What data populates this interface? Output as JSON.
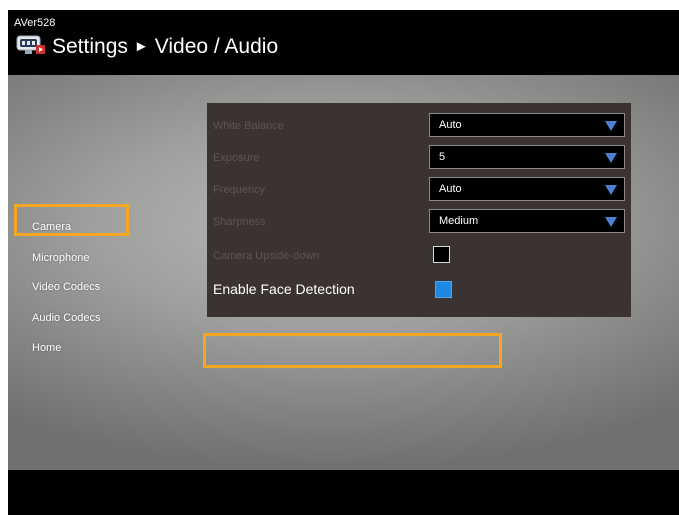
{
  "header": {
    "device_name": "AVer528",
    "app_icon": "aver-camera-logo-icon",
    "breadcrumb": {
      "section": "Settings",
      "separator": "►",
      "page": "Video / Audio"
    }
  },
  "sidebar": {
    "items": [
      {
        "label": "Camera",
        "selected": true
      },
      {
        "label": "Microphone"
      },
      {
        "label": "Video Codecs"
      },
      {
        "label": "Audio Codecs"
      },
      {
        "label": "Home"
      }
    ]
  },
  "settings": {
    "white_balance": {
      "label": "White Balance",
      "value": "Auto"
    },
    "exposure": {
      "label": "Exposure",
      "value": "5"
    },
    "frequency": {
      "label": "Frequency",
      "value": "Auto"
    },
    "sharpness": {
      "label": "Sharpness",
      "value": "Medium"
    },
    "upside_down": {
      "label": "Camera Upside-down",
      "checked": false
    },
    "face_detection": {
      "label": "Enable Face Detection",
      "checked": true
    }
  },
  "colors": {
    "highlight": "#f5a623",
    "checkbox_checked": "#1e88e5",
    "dropdown_arrow": "#4a7fd4",
    "panel_bg": "#3a3332"
  }
}
